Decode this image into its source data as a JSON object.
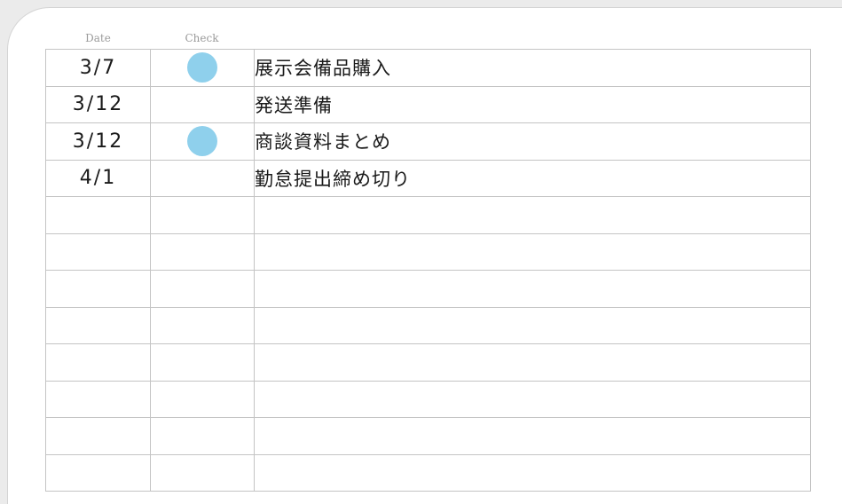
{
  "headers": {
    "date": "Date",
    "check": "Check"
  },
  "colors": {
    "check_dot": "#8fd0ec"
  },
  "rows": [
    {
      "date": "3/7",
      "checked": true,
      "task": "展示会備品購入"
    },
    {
      "date": "3/12",
      "checked": false,
      "task": "発送準備"
    },
    {
      "date": "3/12",
      "checked": true,
      "task": "商談資料まとめ"
    },
    {
      "date": "4/1",
      "checked": false,
      "task": "勤怠提出締め切り"
    },
    {
      "date": "",
      "checked": false,
      "task": ""
    },
    {
      "date": "",
      "checked": false,
      "task": ""
    },
    {
      "date": "",
      "checked": false,
      "task": ""
    },
    {
      "date": "",
      "checked": false,
      "task": ""
    },
    {
      "date": "",
      "checked": false,
      "task": ""
    },
    {
      "date": "",
      "checked": false,
      "task": ""
    },
    {
      "date": "",
      "checked": false,
      "task": ""
    },
    {
      "date": "",
      "checked": false,
      "task": ""
    }
  ]
}
